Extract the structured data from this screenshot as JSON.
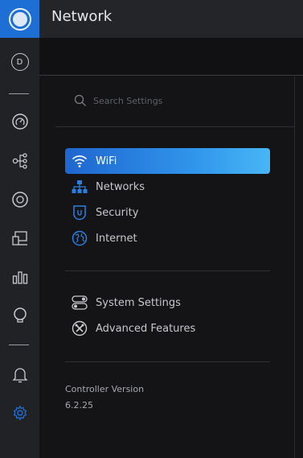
{
  "app": {
    "title": "Network"
  },
  "rail": {
    "avatar_letter": "D",
    "items": [
      {
        "icon": "dashboard-icon"
      },
      {
        "icon": "topology-icon"
      },
      {
        "icon": "devices-icon"
      },
      {
        "icon": "clients-icon"
      },
      {
        "icon": "statistics-icon"
      },
      {
        "icon": "insights-icon"
      },
      {
        "icon": "alerts-icon"
      },
      {
        "icon": "settings-icon"
      }
    ],
    "active_color": "#1f6fd6"
  },
  "search": {
    "placeholder": "Search Settings"
  },
  "settings_nav": {
    "primary": [
      {
        "label": "WiFi",
        "icon": "wifi-icon",
        "active": true
      },
      {
        "label": "Networks",
        "icon": "networks-icon",
        "active": false
      },
      {
        "label": "Security",
        "icon": "security-shield-icon",
        "active": false
      },
      {
        "label": "Internet",
        "icon": "globe-icon",
        "active": false
      }
    ],
    "secondary": [
      {
        "label": "System Settings",
        "icon": "toggles-icon"
      },
      {
        "label": "Advanced Features",
        "icon": "advanced-tools-icon"
      }
    ]
  },
  "controller": {
    "title": "Controller Version",
    "version": "6.2.25"
  },
  "colors": {
    "accent": "#1d6fd6",
    "active_gradient_end": "#47b6f5",
    "rail_bg": "#202226",
    "panel_bg": "#141416"
  }
}
